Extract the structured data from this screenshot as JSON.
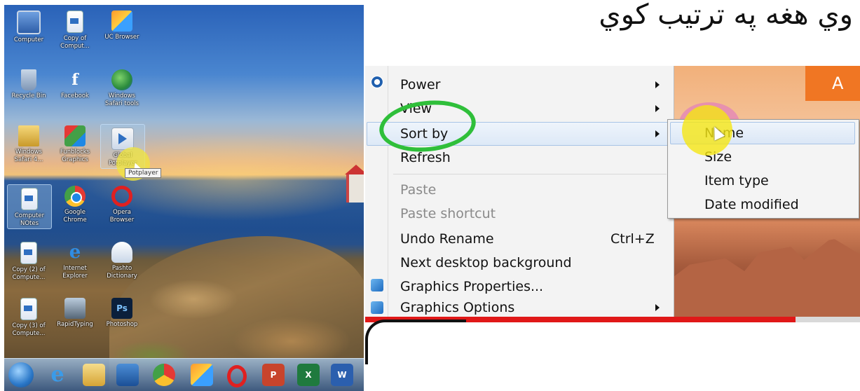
{
  "title": "وي هغه په ترتيب کوي",
  "desktop": {
    "icons": [
      {
        "label": "Computer",
        "icon": "computer-icon"
      },
      {
        "label": "Copy of Comput...",
        "icon": "document-icon"
      },
      {
        "label": "UC Browser",
        "icon": "uc-browser-icon"
      },
      {
        "label": "Recycle Bin",
        "icon": "recycle-bin-icon"
      },
      {
        "label": "Facebook",
        "icon": "facebook-icon"
      },
      {
        "label": "Windows Safari tools",
        "icon": "globe-icon"
      },
      {
        "label": "Windows Safari 4...",
        "icon": "folder-icon"
      },
      {
        "label": "Funblocks Graphics",
        "icon": "graphics-icon"
      },
      {
        "label": "Global Potplayer",
        "icon": "potplayer-icon"
      },
      {
        "label": "Computer NOtes",
        "icon": "document-icon"
      },
      {
        "label": "Google Chrome",
        "icon": "chrome-icon"
      },
      {
        "label": "Opera Browser",
        "icon": "opera-icon"
      },
      {
        "label": "Copy (2) of Compute...",
        "icon": "document-icon"
      },
      {
        "label": "Internet Explorer",
        "icon": "internet-explorer-icon"
      },
      {
        "label": "Pashto Dictionary",
        "icon": "dictionary-icon"
      },
      {
        "label": "Copy (3) of Compute...",
        "icon": "document-icon"
      },
      {
        "label": "RapidTyping",
        "icon": "keyboard-icon"
      },
      {
        "label": "Photoshop",
        "icon": "photoshop-icon"
      }
    ],
    "tooltip": "Potplayer",
    "taskbar": {
      "ppt": "P",
      "excel": "X",
      "word": "W"
    }
  },
  "context_menu": {
    "items": [
      {
        "label": "Power",
        "submenu": true,
        "icon": "power-icon"
      },
      {
        "label": "View",
        "submenu": true
      },
      {
        "label": "Sort by",
        "submenu": true
      },
      {
        "label": "Refresh"
      },
      {
        "label": "Paste",
        "disabled": true
      },
      {
        "label": "Paste shortcut",
        "disabled": true
      },
      {
        "label": "Undo Rename",
        "shortcut": "Ctrl+Z"
      },
      {
        "label": "Next desktop background"
      },
      {
        "label": "Graphics Properties...",
        "icon": "graphics-properties-icon"
      },
      {
        "label": "Graphics Options",
        "submenu": true,
        "icon": "graphics-options-icon"
      }
    ],
    "sort_submenu": [
      "Name",
      "Size",
      "Item type",
      "Date modified"
    ],
    "wallpaper_button": "A"
  },
  "video": {
    "progress": 0.87
  }
}
